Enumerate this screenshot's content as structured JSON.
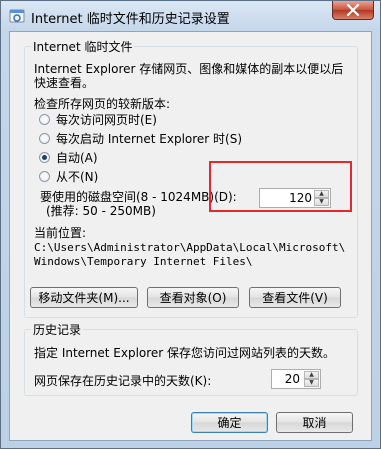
{
  "window": {
    "title": "Internet 临时文件和历史记录设置",
    "accent_close": "#c9513c"
  },
  "temp_files": {
    "group_title": "Internet 临时文件",
    "description_line1": "Internet Explorer 存储网页、图像和媒体的副本以便以后",
    "description_line2": "快速查看。",
    "check_label": "检查所存网页的较新版本:",
    "options": [
      {
        "label": "每次访问网页时(E)",
        "selected": false
      },
      {
        "label": "每次启动 Internet Explorer 时(S)",
        "selected": false
      },
      {
        "label": "自动(A)",
        "selected": true
      },
      {
        "label": "从不(N)",
        "selected": false
      }
    ],
    "disk_label_line1": "要使用的磁盘空间(8 - 1024MB)(D):",
    "disk_label_line2": "(推荐: 50 - 250MB)",
    "disk_value": "120",
    "location_label": "当前位置:",
    "location_path_line1": "C:\\Users\\Administrator\\AppData\\Local\\Microsoft\\",
    "location_path_line2": "Windows\\Temporary Internet Files\\",
    "buttons": {
      "move_folder": "移动文件夹(M)...",
      "view_objects": "查看对象(O)",
      "view_files": "查看文件(V)"
    }
  },
  "history": {
    "group_title": "历史记录",
    "description": "指定 Internet Explorer 保存您访问过网站列表的天数。",
    "days_label": "网页保存在历史记录中的天数(K):",
    "days_value": "20"
  },
  "footer": {
    "ok": "确定",
    "cancel": "取消"
  }
}
